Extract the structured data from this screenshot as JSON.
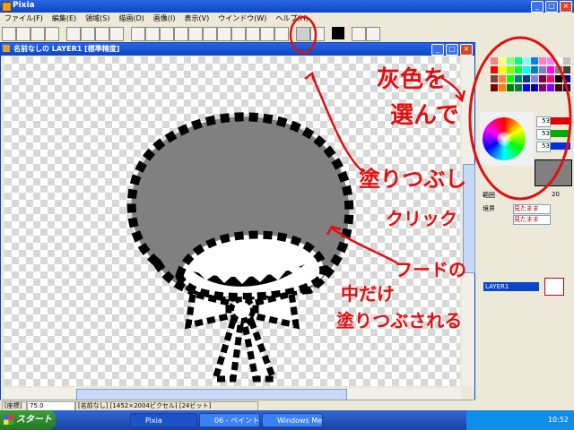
{
  "app": {
    "title": "Pixia"
  },
  "menu": [
    "ファイル(F)",
    "編集(E)",
    "領域(S)",
    "描画(D)",
    "画像(I)",
    "表示(V)",
    "ウインドウ(W)",
    "ヘルプ(H)"
  ],
  "document": {
    "title": "名前なしの LAYER1 [標準精度]"
  },
  "status": {
    "coord_label": "[座標]",
    "zoom": "75.0",
    "info": "[名前なし] [1452×2004ピクセル] [24ビット]"
  },
  "right_panel": {
    "rgb": [
      {
        "value": "53",
        "color": "#e00000"
      },
      {
        "value": "53",
        "color": "#00b000"
      },
      {
        "value": "53",
        "color": "#0030e0"
      }
    ],
    "size_value": "20",
    "labels": {
      "range": "範囲",
      "border": "境界"
    },
    "buttons": {
      "visible1": "見たまま",
      "visible2": "見たまま"
    },
    "layer_name": "LAYER1",
    "foreground_color": "#808080",
    "palette_colors": [
      "#ff8080",
      "#ffff80",
      "#80ff80",
      "#00ff80",
      "#80ffff",
      "#0080ff",
      "#ff80c0",
      "#ff80ff",
      "#ffffff",
      "#c0c0c0",
      "#ff0000",
      "#ffff00",
      "#80ff00",
      "#00ff40",
      "#00ffff",
      "#0080c0",
      "#8080c0",
      "#ff00ff",
      "#808080",
      "#404040",
      "#804040",
      "#ff8040",
      "#00ff00",
      "#008080",
      "#004080",
      "#8080ff",
      "#800040",
      "#ff0080",
      "#000000",
      "#000080",
      "#800000",
      "#ff8000",
      "#008000",
      "#008040",
      "#0000ff",
      "#0000a0",
      "#800080",
      "#8000ff",
      "#400000",
      "#000040"
    ]
  },
  "annotations": {
    "line1": "灰色を",
    "line2": "選んで",
    "line3": "塗りつぶし",
    "line4": "クリック",
    "line5": "フードの",
    "line6": "中だけ",
    "line7": "塗りつぶされる"
  },
  "taskbar": {
    "start": "スタート",
    "tasks": [
      "Pixia",
      "06 - ペイント",
      "Windows Me..."
    ],
    "clock": "10:52"
  }
}
